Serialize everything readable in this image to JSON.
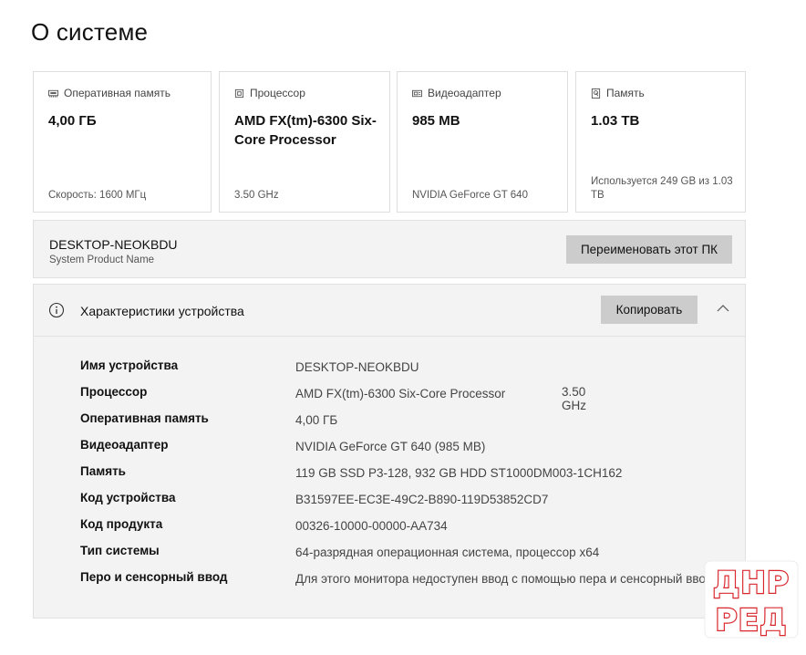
{
  "page_title": "О системе",
  "cards": [
    {
      "icon": "ram-icon",
      "label": "Оперативная память",
      "value": "4,00 ГБ",
      "footer": "Скорость: 1600 МГц"
    },
    {
      "icon": "cpu-icon",
      "label": "Процессор",
      "value": "AMD FX(tm)-6300 Six-Core Processor",
      "footer": "3.50 GHz"
    },
    {
      "icon": "gpu-icon",
      "label": "Видеоадаптер",
      "value": "985 MB",
      "footer": "NVIDIA GeForce GT 640"
    },
    {
      "icon": "storage-icon",
      "label": "Память",
      "value": "1.03 TB",
      "footer": "Используется 249 GB из 1.03 TB"
    }
  ],
  "device": {
    "name": "DESKTOP-NEOKBDU",
    "subtitle": "System Product Name",
    "rename_label": "Переименовать этот ПК"
  },
  "specs": {
    "title": "Характеристики устройства",
    "copy_label": "Копировать",
    "rows": [
      {
        "label": "Имя устройства",
        "value": "DESKTOP-NEOKBDU"
      },
      {
        "label": "Процессор",
        "value": "AMD FX(tm)-6300 Six-Core Processor",
        "extra": "3.50 GHz"
      },
      {
        "label": "Оперативная память",
        "value": "4,00 ГБ"
      },
      {
        "label": "Видеоадаптер",
        "value": "NVIDIA GeForce GT 640 (985 MB)"
      },
      {
        "label": "Память",
        "value": "119 GB SSD P3-128, 932 GB HDD ST1000DM003-1CH162"
      },
      {
        "label": "Код устройства",
        "value": "B31597EE-EC3E-49C2-B890-119D53852CD7"
      },
      {
        "label": "Код продукта",
        "value": "00326-10000-00000-AA734"
      },
      {
        "label": "Тип системы",
        "value": "64-разрядная операционная система, процессор x64"
      },
      {
        "label": "Перо и сенсорный ввод",
        "value": "Для этого монитора недоступен ввод с помощью пера и сенсорный ввод"
      }
    ]
  },
  "watermark": {
    "line1": "ДНР",
    "line2": "РЕД",
    "color": "#d9272e"
  }
}
